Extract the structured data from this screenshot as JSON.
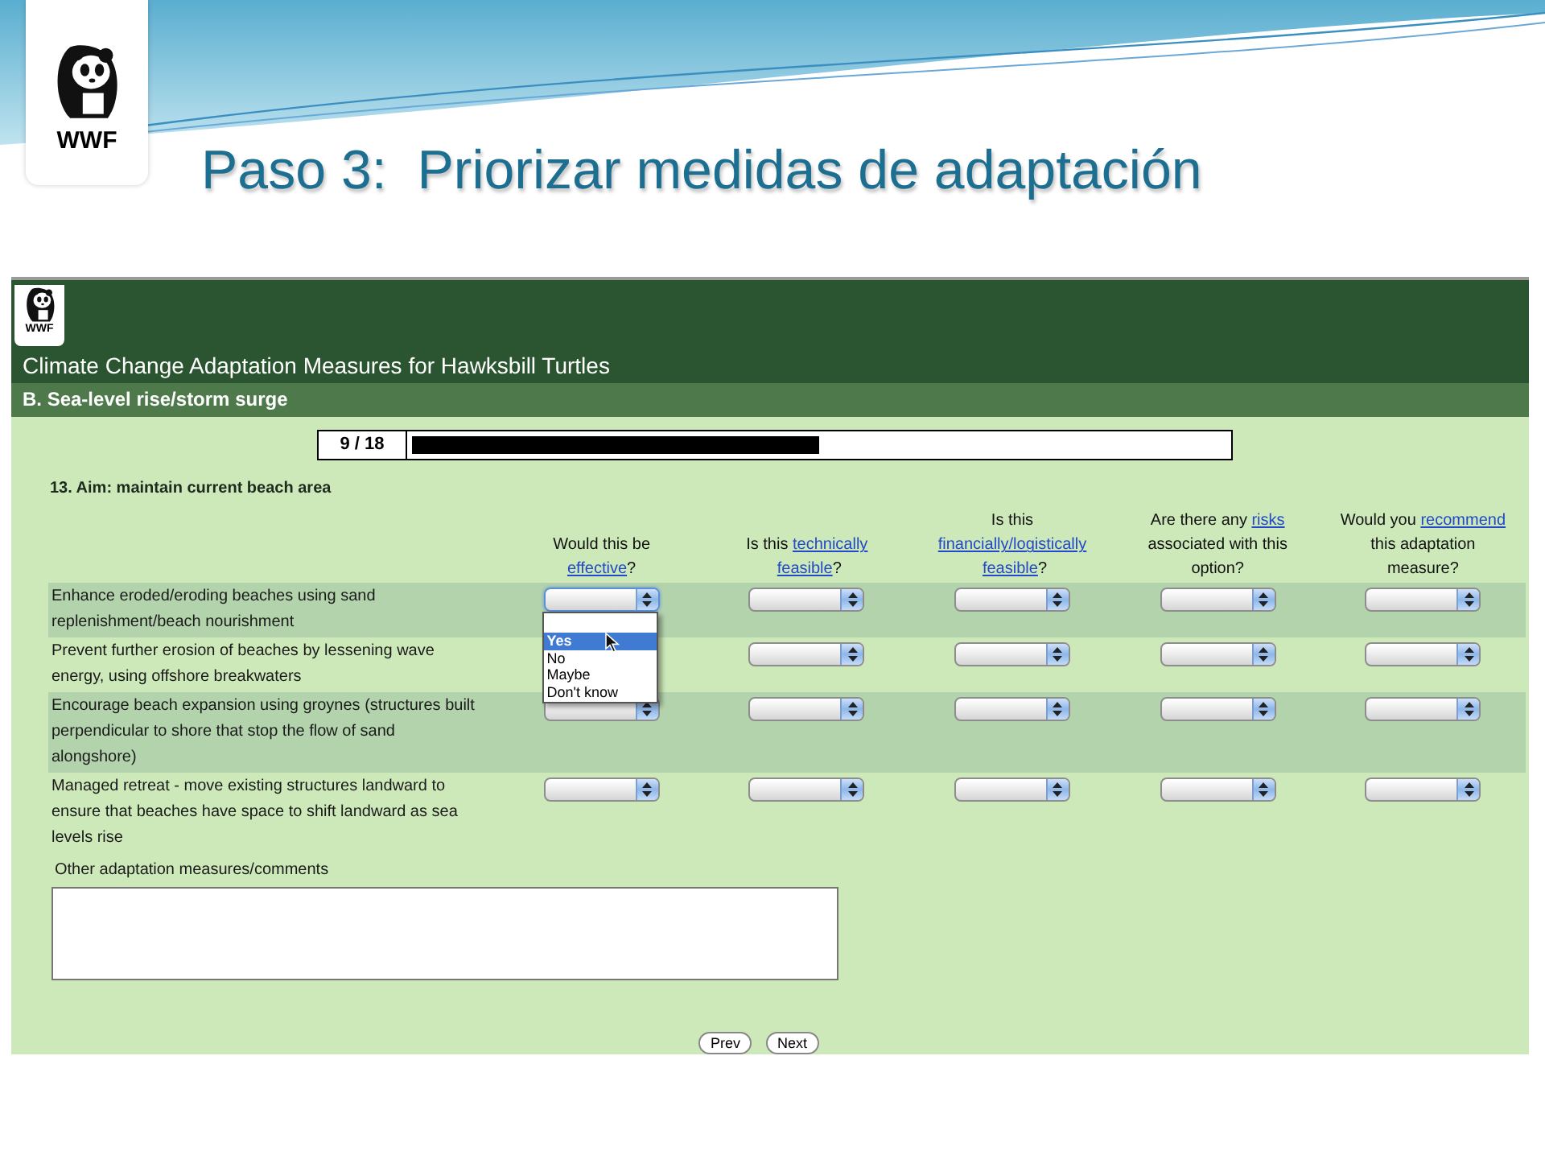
{
  "slide": {
    "logo_text": "WWF",
    "title": "Paso 3:  Priorizar medidas de adaptación"
  },
  "page": {
    "logo_text": "WWF",
    "title": "Climate Change Adaptation Measures for Hawksbill Turtles",
    "section": "B. Sea-level rise/storm surge",
    "progress": {
      "label": "9 / 18",
      "level": 0.5
    },
    "question": "13. Aim: maintain current beach area",
    "columns": [
      {
        "parts": [
          {
            "kind": "text",
            "text": "Would this be "
          },
          {
            "kind": "link",
            "text": "effective"
          },
          {
            "kind": "text",
            "text": "?"
          }
        ]
      },
      {
        "parts": [
          {
            "kind": "text",
            "text": "Is this "
          },
          {
            "kind": "link",
            "text": "technically"
          },
          {
            "kind": "link",
            "text": "feasible"
          },
          {
            "kind": "text",
            "text": "?"
          }
        ]
      },
      {
        "parts": [
          {
            "kind": "text",
            "text": "Is this "
          },
          {
            "kind": "link",
            "text": "financially/logistically"
          },
          {
            "kind": "link",
            "text": "feasible"
          },
          {
            "kind": "text",
            "text": "?"
          }
        ]
      },
      {
        "parts": [
          {
            "kind": "text",
            "text": "Are there any "
          },
          {
            "kind": "link",
            "text": "risks"
          },
          {
            "kind": "text",
            "text": " associated with this option?"
          }
        ]
      },
      {
        "parts": [
          {
            "kind": "text",
            "text": "Would you "
          },
          {
            "kind": "link",
            "text": "recommend"
          },
          {
            "kind": "text",
            "text": " this adaptation measure?"
          }
        ]
      }
    ],
    "rows": [
      {
        "label": "Enhance eroded/eroding beaches using sand replenishment/beach nourishment",
        "shaded": true,
        "selects": [
          {
            "open": true,
            "options": [
              {
                "text": "Yes",
                "selected": true
              },
              {
                "text": "No",
                "selected": false
              },
              {
                "text": "Maybe",
                "selected": false
              },
              {
                "text": "Don't know",
                "selected": false
              }
            ]
          },
          {
            "open": false
          },
          {
            "open": false
          },
          {
            "open": false
          },
          {
            "open": false
          }
        ]
      },
      {
        "label": "Prevent further erosion of beaches by lessening wave energy, using offshore breakwaters",
        "shaded": false,
        "selects": [
          {
            "open": false
          },
          {
            "open": false
          },
          {
            "open": false
          },
          {
            "open": false
          }
        ]
      },
      {
        "label": "Encourage beach expansion using groynes (structures built perpendicular to shore that stop the flow of sand alongshore)",
        "shaded": true,
        "selects": [
          {
            "open": false
          },
          {
            "open": false
          },
          {
            "open": false
          },
          {
            "open": false
          },
          {
            "open": false
          }
        ]
      },
      {
        "label": "Managed retreat - move existing structures landward to ensure that beaches have space to shift landward as sea levels rise",
        "shaded": false,
        "selects": [
          {
            "open": false
          },
          {
            "open": false
          },
          {
            "open": false
          },
          {
            "open": false
          },
          {
            "open": false
          }
        ]
      }
    ],
    "comments_label": "Other adaptation measures/comments",
    "buttons": [
      "Prev",
      "Next"
    ]
  }
}
